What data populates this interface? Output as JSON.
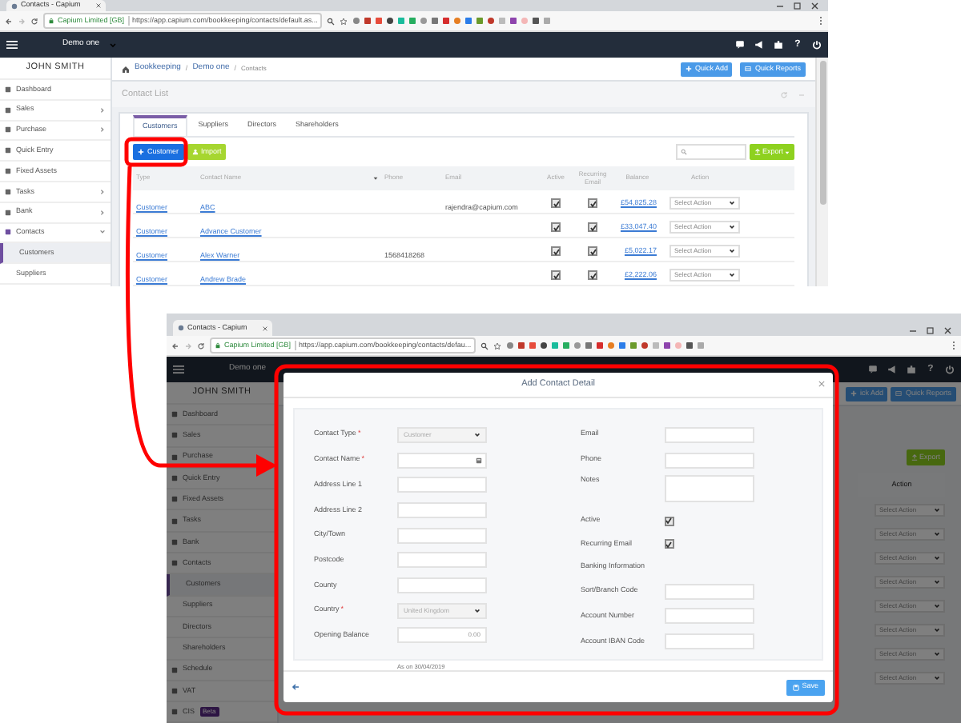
{
  "top_screen": {
    "browser": {
      "tab_title": "Contacts - Capium",
      "site": "Capium Limited [GB]",
      "url": "https://app.capium.com/bookkeeping/contacts/default.as..."
    },
    "navbar": {
      "company": "Demo one",
      "help": "?"
    },
    "sidebar": {
      "user": "JOHN SMITH",
      "items": [
        {
          "label": "Dashboard",
          "kind": "link",
          "selected": false
        },
        {
          "label": "Sales",
          "kind": "group",
          "expanded": false,
          "selected": false
        },
        {
          "label": "Purchase",
          "kind": "group",
          "expanded": false,
          "selected": false
        },
        {
          "label": "Quick Entry",
          "kind": "link",
          "selected": false
        },
        {
          "label": "Fixed Assets",
          "kind": "link",
          "selected": false
        },
        {
          "label": "Tasks",
          "kind": "group",
          "expanded": false,
          "selected": false
        },
        {
          "label": "Bank",
          "kind": "group",
          "expanded": false,
          "selected": false
        },
        {
          "label": "Contacts",
          "kind": "group",
          "expanded": true,
          "selected": false
        },
        {
          "label": "Customers",
          "kind": "sub",
          "selected": true
        },
        {
          "label": "Suppliers",
          "kind": "sub",
          "selected": false
        }
      ]
    },
    "breadcrumb": {
      "separator": "/",
      "items": [
        "Bookkeeping",
        "Demo one",
        "Contacts"
      ]
    },
    "header_buttons": [
      "Quick Add",
      "Quick Reports"
    ],
    "page_title": "Contact List",
    "tabs": [
      {
        "label": "Customers",
        "selected": true
      },
      {
        "label": "Suppliers",
        "selected": false
      },
      {
        "label": "Directors",
        "selected": false
      },
      {
        "label": "Shareholders",
        "selected": false
      }
    ],
    "toolbar": {
      "buttons": [
        {
          "label": "Customer",
          "kind": "primary"
        },
        {
          "label": "Import",
          "kind": "secondary"
        }
      ],
      "export": "Export"
    },
    "table": {
      "columns": [
        "Type",
        "Contact Name",
        "Phone",
        "Email",
        "Active",
        "Recurring Email",
        "Balance",
        "Action"
      ],
      "rows": [
        {
          "type": "Customer",
          "name": "ABC",
          "phone": "",
          "email": "rajendra@capium.com",
          "active": true,
          "recurring_email": true,
          "balance": "£54,825.28",
          "action": "Select Action"
        },
        {
          "type": "Customer",
          "name": "Advance Customer",
          "phone": "",
          "email": "",
          "active": true,
          "recurring_email": true,
          "balance": "£33,047.40",
          "action": "Select Action"
        },
        {
          "type": "Customer",
          "name": "Alex Warner",
          "phone": "1568418268",
          "email": "",
          "active": true,
          "recurring_email": true,
          "balance": "£5,022.17",
          "action": "Select Action"
        },
        {
          "type": "Customer",
          "name": "Andrew Brade",
          "phone": "",
          "email": "",
          "active": true,
          "recurring_email": true,
          "balance": "£2,222.06",
          "action": "Select Action"
        }
      ]
    }
  },
  "dialog_screen": {
    "browser": {
      "tab_title": "Contacts - Capium",
      "site": "Capium Limited [GB]",
      "url": "https://app.capium.com/bookkeeping/contacts/defau..."
    },
    "navbar": {
      "company": "Demo one",
      "help": "?"
    },
    "sidebar": {
      "user": "JOHN SMITH",
      "items": [
        {
          "label": "Dashboard",
          "kind": "link",
          "selected": false
        },
        {
          "label": "Sales",
          "kind": "link",
          "selected": false
        },
        {
          "label": "Purchase",
          "kind": "link",
          "selected": false
        },
        {
          "label": "Quick Entry",
          "kind": "link",
          "selected": false
        },
        {
          "label": "Fixed Assets",
          "kind": "link",
          "selected": false
        },
        {
          "label": "Tasks",
          "kind": "link",
          "selected": false
        },
        {
          "label": "Bank",
          "kind": "link",
          "selected": false
        },
        {
          "label": "Contacts",
          "kind": "link",
          "selected": false
        },
        {
          "label": "Customers",
          "kind": "sub",
          "selected": true
        },
        {
          "label": "Suppliers",
          "kind": "sub",
          "selected": false
        },
        {
          "label": "Directors",
          "kind": "sub",
          "selected": false
        },
        {
          "label": "Shareholders",
          "kind": "sub",
          "selected": false
        },
        {
          "label": "Schedule",
          "kind": "link",
          "selected": false
        },
        {
          "label": "VAT",
          "kind": "link",
          "selected": false
        },
        {
          "label": "CIS",
          "kind": "link",
          "selected": false,
          "badge": "Beta"
        }
      ]
    },
    "header_buttons": [
      "ick Add",
      "Quick Reports"
    ],
    "export": "Export",
    "action_header": "Action",
    "row_actions": [
      "Select Action",
      "Select Action",
      "Select Action",
      "Select Action",
      "Select Action",
      "Select Action",
      "Select Action",
      "Select Action"
    ],
    "dialog": {
      "title": "Add Contact Detail",
      "required_mark": "*",
      "left_fields": [
        {
          "label": "Contact Type",
          "required": true,
          "kind": "select",
          "value": "Customer"
        },
        {
          "label": "Contact Name",
          "required": true,
          "kind": "lookup"
        },
        {
          "label": "Address Line 1",
          "required": false,
          "kind": "text"
        },
        {
          "label": "Address Line 2",
          "required": false,
          "kind": "text"
        },
        {
          "label": "City/Town",
          "required": false,
          "kind": "text"
        },
        {
          "label": "Postcode",
          "required": false,
          "kind": "text"
        },
        {
          "label": "County",
          "required": false,
          "kind": "text"
        },
        {
          "label": "Country",
          "required": true,
          "kind": "select",
          "value": "United Kingdom"
        },
        {
          "label": "Opening Balance",
          "required": false,
          "kind": "amount",
          "value": "0.00",
          "note": "As on 30/04/2019"
        }
      ],
      "right_fields": [
        {
          "label": "Email",
          "kind": "text"
        },
        {
          "label": "Phone",
          "kind": "text"
        },
        {
          "label": "Notes",
          "kind": "textarea"
        },
        {
          "label": "Active",
          "kind": "checkbox",
          "checked": true
        },
        {
          "label": "Recurring Email",
          "kind": "checkbox",
          "checked": true
        },
        {
          "label": "Banking Information",
          "kind": "heading"
        },
        {
          "label": "Sort/Branch Code",
          "kind": "text"
        },
        {
          "label": "Account Number",
          "kind": "text"
        },
        {
          "label": "Account IBAN Code",
          "kind": "text"
        }
      ],
      "save": "Save"
    }
  }
}
